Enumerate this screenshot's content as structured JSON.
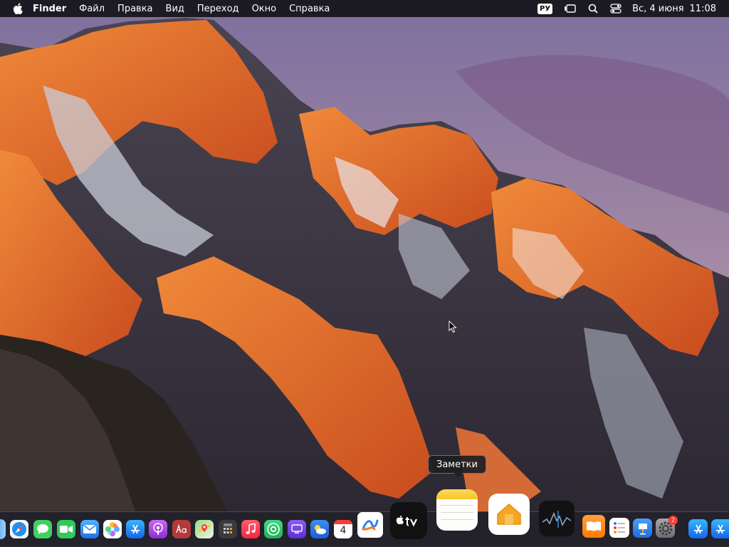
{
  "menubar": {
    "app_name": "Finder",
    "items": [
      "Файл",
      "Правка",
      "Вид",
      "Переход",
      "Окно",
      "Справка"
    ],
    "input_source": "РУ",
    "date": "Вс, 4 июня",
    "time": "11:08"
  },
  "tooltip": {
    "label": "Заметки"
  },
  "dock": {
    "calendar_day": "4",
    "system_settings_badge": "2",
    "items": [
      "finder",
      "safari",
      "messages",
      "facetime",
      "mail",
      "photos",
      "app-store",
      "podcasts",
      "dictionary",
      "maps",
      "calculator",
      "music",
      "find-my",
      "screen-time",
      "weather",
      "calendar",
      "freeform",
      "apple-tv",
      "notes",
      "home",
      "stocks",
      "books",
      "reminders",
      "keynote",
      "system-settings",
      "app-store-2",
      "app-store-3"
    ]
  },
  "colors": {
    "sky_top": "#8a7aa3",
    "sky_bottom": "#c9a5a6",
    "peak_orange": "#e76a2a",
    "rock_dark": "#3a3440"
  }
}
